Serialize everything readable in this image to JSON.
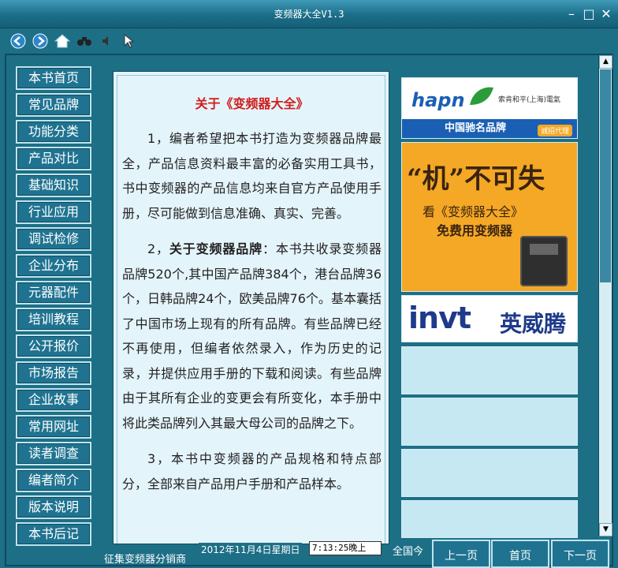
{
  "window": {
    "title": "变频器大全V1.3"
  },
  "nav": {
    "items": [
      "本书首页",
      "常见品牌",
      "功能分类",
      "产品对比",
      "基础知识",
      "行业应用",
      "调试检修",
      "企业分布",
      "元器配件",
      "培训教程",
      "公开报价",
      "市场报告",
      "企业故事",
      "常用网址",
      "读者调查",
      "编者简介",
      "版本说明",
      "本书后记"
    ]
  },
  "content": {
    "title": "关于《变频器大全》",
    "p1": "1，编者希望把本书打造为变频器品牌最全，产品信息资料最丰富的必备实用工具书，书中变频器的产品信息均来自官方产品使用手册，尽可能做到信息准确、真实、完善。",
    "p2_prefix": "2，",
    "p2_bold": "关于变频器品牌",
    "p2_rest": "：本书共收录变频器品牌520个,其中国产品牌384个，港台品牌36个，日韩品牌24个，欧美品牌76个。基本囊括了中国市场上现有的所有品牌。有些品牌已经不再使用，但编者依然录入，作为历史的记录，并提供应用手册的下载和阅读。有些品牌由于其所有企业的变更会有所变化，本手册中将此类品牌列入其最大母公司的品牌之下。",
    "p3": "3，本书中变频器的产品规格和特点部分，全部来自产品用户手册和产品样本。"
  },
  "ads": {
    "ad1": {
      "logo": "hapn",
      "cn": "索肯和平(上海)電氣",
      "band": "中国驰名品牌",
      "tag": "诚招代理"
    },
    "ad2": {
      "headline": "“机”不可失",
      "line1": "看《变频器大全》",
      "line2": "免费用变频器"
    },
    "ad3": {
      "logo": "invt",
      "cn": "英威腾"
    }
  },
  "bottom": {
    "marquee": "征集变频器分销商",
    "date": "2012年11月4日星期日",
    "time": "7:13:25晚上",
    "nation": "全国今",
    "prev": "上一页",
    "home": "首页",
    "next": "下一页"
  },
  "colors": {
    "bg": "#1d6f86",
    "accent_red": "#d11c1c",
    "panel": "#e4f4fb"
  }
}
